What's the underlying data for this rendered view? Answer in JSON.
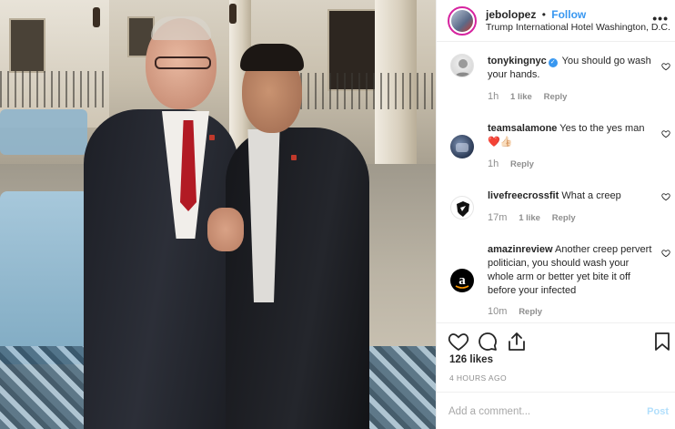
{
  "post": {
    "username": "jebolopez",
    "separator": "•",
    "follow_label": "Follow",
    "location": "Trump International Hotel Washington, D.C.",
    "more_icon": "more-options-icon",
    "photo_icon": "post-photo"
  },
  "comments": [
    {
      "username": "tonykingnyc",
      "verified": true,
      "text": "You should go wash your hands.",
      "time": "1h",
      "likes": "1 like",
      "reply": "Reply"
    },
    {
      "username": "teamsalamone",
      "verified": false,
      "text": "Yes to the yes man",
      "emoji": "❤️👍🏻",
      "time": "1h",
      "likes": "",
      "reply": "Reply"
    },
    {
      "username": "livefreecrossfit",
      "verified": false,
      "text": "What a creep",
      "time": "17m",
      "likes": "1 like",
      "reply": "Reply"
    },
    {
      "username": "amazinreview",
      "verified": false,
      "text": "Another creep pervert politician, you should wash your whole arm or better yet bite it off before your infected",
      "time": "10m",
      "likes": "",
      "reply": "Reply"
    }
  ],
  "stats": {
    "likes": "126 likes",
    "time_ago": "4 HOURS AGO"
  },
  "composer": {
    "placeholder": "Add a comment...",
    "post_label": "Post"
  },
  "colors": {
    "accent_blue": "#3897f0",
    "post_disabled": "#b2dffc",
    "muted": "#8e8e8e",
    "heart_red": "#ed4956"
  }
}
